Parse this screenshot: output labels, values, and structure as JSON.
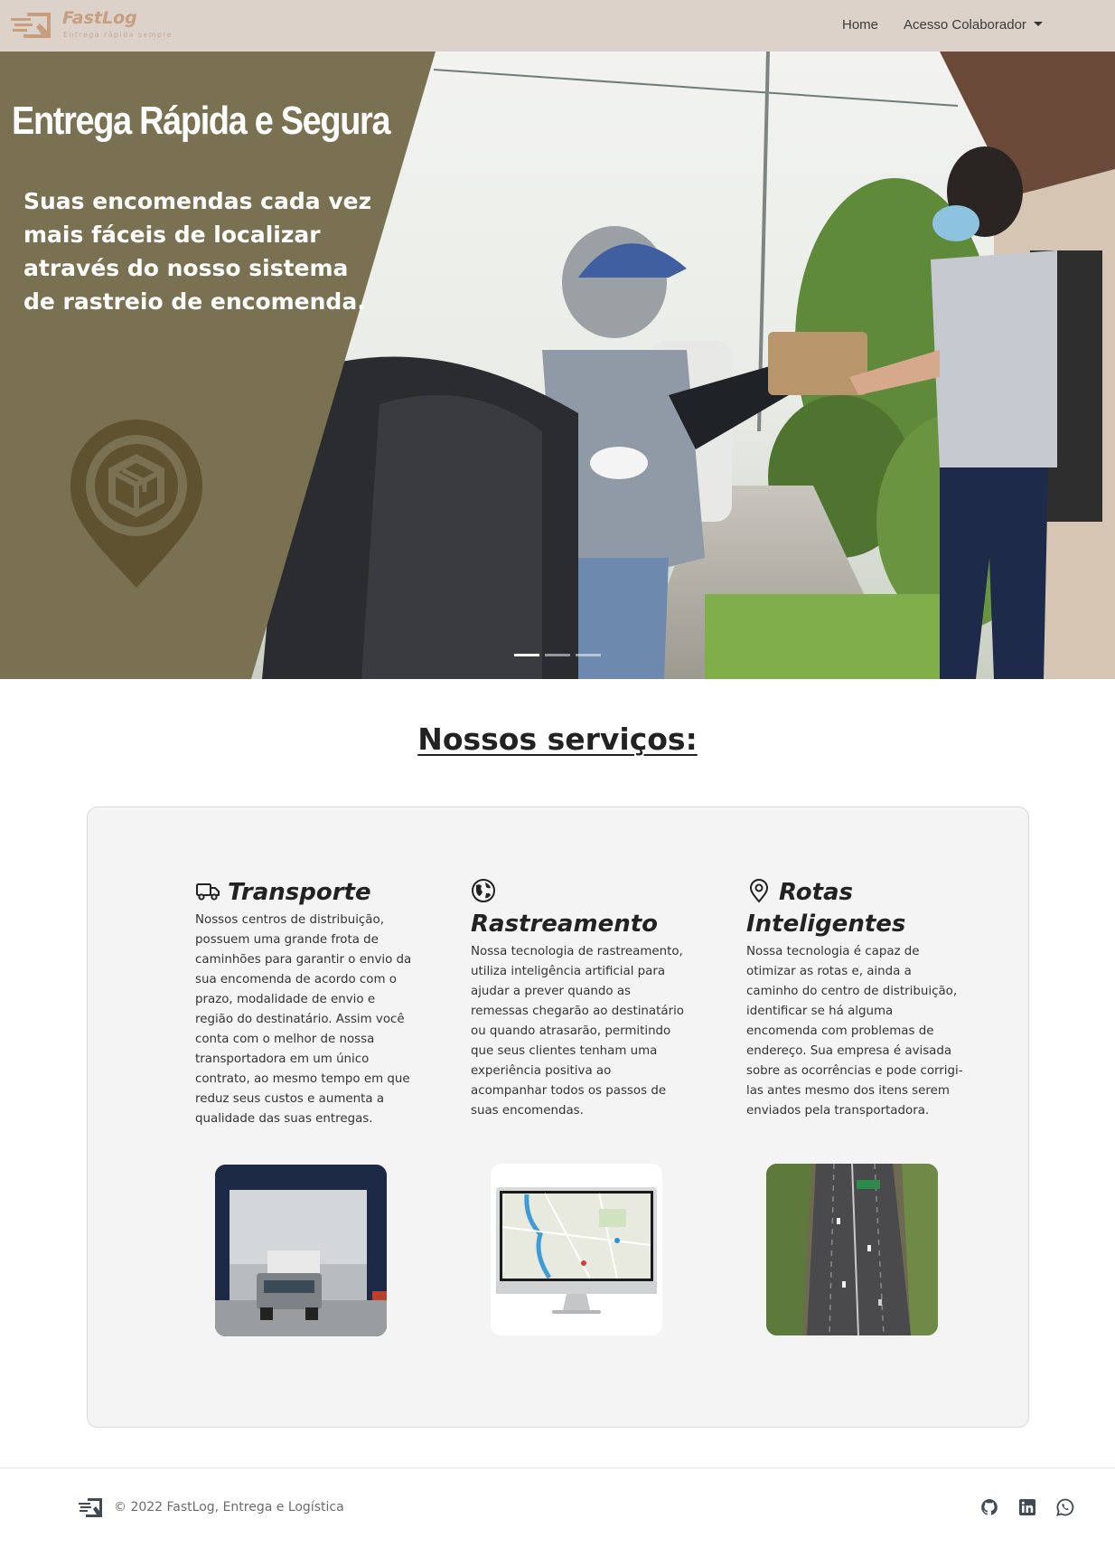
{
  "navbar": {
    "brand_name": "FastLog",
    "brand_tagline": "Entrega rápida sempre",
    "links": [
      {
        "label": "Home"
      },
      {
        "label": "Acesso Colaborador"
      }
    ]
  },
  "hero": {
    "title": "Entrega Rápida e Segura",
    "subtitle": "Suas encomendas cada vez mais fáceis de localizar através do nosso sistema de rastreio de encomenda.",
    "slide_count": 3,
    "active_slide": 1
  },
  "services": {
    "heading": "Nossos serviços:",
    "items": [
      {
        "title": "Transporte",
        "icon": "truck-icon",
        "text": "Nossos centros de distribuição, possuem uma grande frota de caminhões para garantir o envio da sua encomenda de acordo com o prazo, modalidade de envio e região do destinatário. Assim você conta com o melhor de nossa transportadora em um único contrato, ao mesmo tempo em que reduz seus custos e aumenta a qualidade das suas entregas."
      },
      {
        "title": "Rastreamento",
        "icon": "globe-icon",
        "text": "Nossa tecnologia de rastreamento, utiliza inteligência artificial para ajudar a prever quando as remessas chegarão ao destinatário ou quando atrasarão, permitindo que seus clientes tenham uma experiência positiva ao acompanhar todos os passos de suas encomendas."
      },
      {
        "title": "Rotas Inteligentes",
        "icon": "map-pin-icon",
        "text": "Nossa tecnologia é capaz de otimizar as rotas e, ainda a caminho do centro de distribuição, identificar se há alguma encomenda com problemas de endereço. Sua empresa é avisada sobre as ocorrências e pode corrigi-las antes mesmo dos itens serem enviados pela transportadora."
      }
    ]
  },
  "footer": {
    "copyright": "© 2022 FastLog, Entrega e Logística",
    "social": [
      {
        "icon": "github-icon"
      },
      {
        "icon": "linkedin-icon"
      },
      {
        "icon": "whatsapp-icon"
      }
    ]
  },
  "colors": {
    "navbar_bg": "#dcd2c9",
    "brand": "#c79e80",
    "hero_panel": "#7a7152",
    "card_bg": "#f4f4f4"
  }
}
